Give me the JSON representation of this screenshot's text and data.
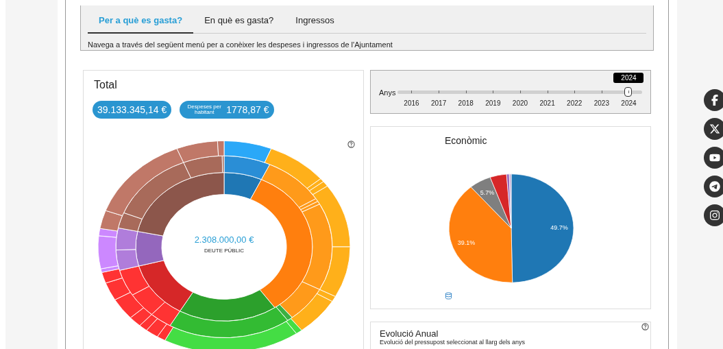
{
  "tabs_panel": {
    "tabs": [
      {
        "label": "Per a què es gasta?",
        "selected": true
      },
      {
        "label": "En què es gasta?",
        "selected": false
      },
      {
        "label": "Ingressos",
        "selected": false
      }
    ],
    "description": "Navega a través del següent menú per a conèixer les despeses i ingressos de l'Ajuntament"
  },
  "total_card": {
    "title": "Total",
    "total_badge": "39.133.345,14 €",
    "per_capita_label": "Despeses per habitant",
    "per_capita_value": "1778,87 €",
    "center_value": "2.308.000,00 €",
    "center_label": "DEUTE PÚBLIC"
  },
  "year_slider": {
    "label": "Anys",
    "value": "2024",
    "level": 1,
    "years": [
      "2016",
      "2017",
      "2018",
      "2019",
      "2020",
      "2021",
      "2022",
      "2023",
      "2024"
    ]
  },
  "economic_card": {
    "title": "Econòmic",
    "chart_data": {
      "type": "pie",
      "values": [
        49.7,
        39.1,
        5.7,
        4.3,
        0.7,
        0.5
      ],
      "colors": [
        "#1f77b4",
        "#ff7f0e",
        "#7f7f7f",
        "#d62728",
        "#9467bd",
        "#c5b0d5"
      ],
      "value_labels": [
        "49.7%",
        "39.1%",
        "5.7%",
        null,
        null,
        null
      ]
    }
  },
  "evolution_card": {
    "title": "Evolució Anual",
    "subtitle": "Evolució del pressupost seleccionat al llarg dels anys"
  }
}
